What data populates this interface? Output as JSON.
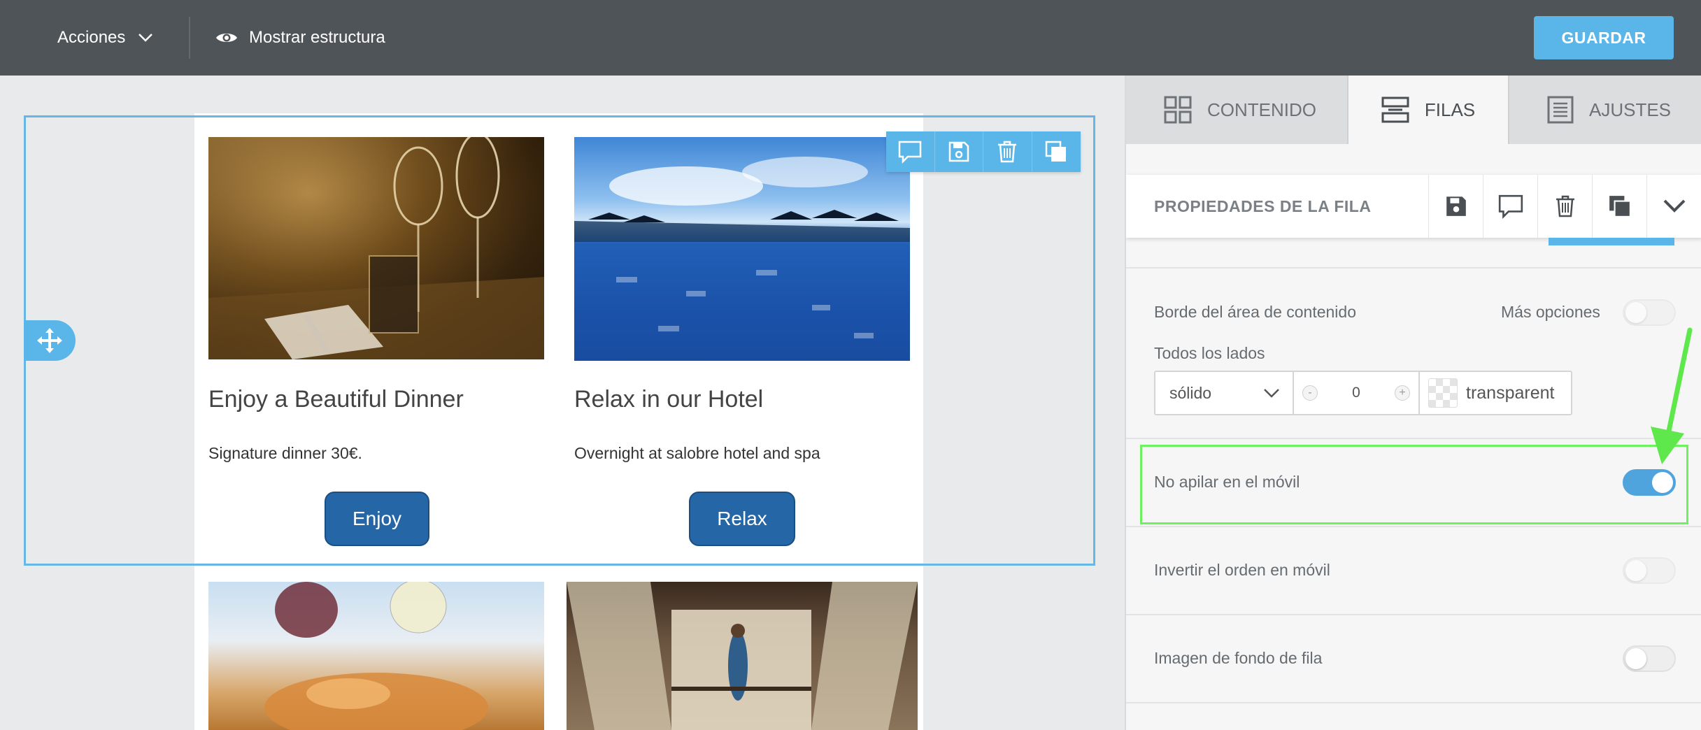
{
  "topbar": {
    "actions_label": "Acciones",
    "structure_label": "Mostrar estructura",
    "save_label": "GUARDAR"
  },
  "canvas": {
    "columns": [
      {
        "title": "Enjoy a Beautiful Dinner",
        "text": "Signature dinner 30€.",
        "button": "Enjoy"
      },
      {
        "title": "Relax in our Hotel",
        "text": "Overnight at salobre hotel and spa",
        "button": "Relax"
      }
    ],
    "row_toolbar_icons": [
      "comment-icon",
      "save-icon",
      "trash-icon",
      "duplicate-icon"
    ],
    "move_handle_icon": "move-arrows-icon"
  },
  "panel": {
    "tabs": [
      {
        "label": "CONTENIDO",
        "icon": "grid-icon",
        "active": false
      },
      {
        "label": "FILAS",
        "icon": "rows-icon",
        "active": true
      },
      {
        "label": "AJUSTES",
        "icon": "settings-list-icon",
        "active": false
      }
    ],
    "header": {
      "title": "PROPIEDADES DE LA FILA",
      "icons": [
        "save-icon",
        "comment-icon",
        "trash-icon",
        "duplicate-icon",
        "chevron-down-icon"
      ]
    },
    "border": {
      "label": "Borde del área de contenido",
      "more_options": "Más opciones",
      "more_options_on": false,
      "all_sides": "Todos los lados",
      "style": "sólido",
      "width_value": "0",
      "minus": "-",
      "plus": "+",
      "color": "transparent"
    },
    "no_stack": {
      "label": "No apilar en el móvil",
      "on": true
    },
    "reverse": {
      "label": "Invertir el orden en móvil",
      "on": false
    },
    "bg_image": {
      "label": "Imagen de fondo de fila",
      "on": false
    }
  },
  "colors": {
    "topbar": "#4f5459",
    "accent": "#5ab6e8",
    "button_blue": "#2566a6",
    "highlight_green": "#6cf25e",
    "arrow_green": "#5ee84b"
  }
}
